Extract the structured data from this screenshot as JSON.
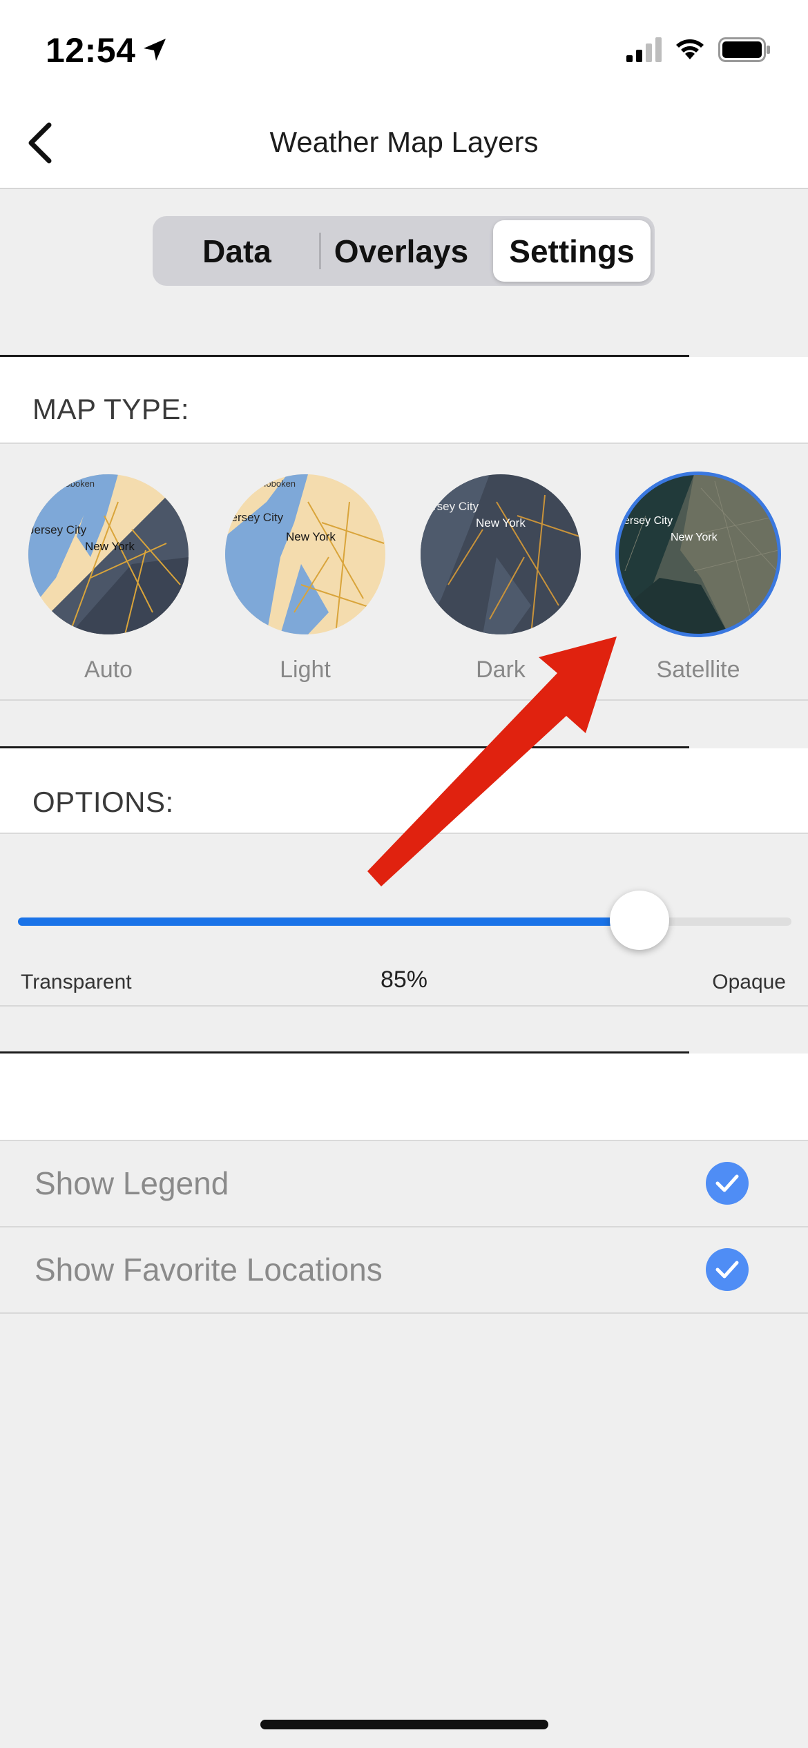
{
  "status_bar": {
    "time": "12:54",
    "icons": [
      "location-arrow-icon",
      "cellular-signal-icon",
      "wifi-icon",
      "battery-icon"
    ]
  },
  "nav": {
    "title": "Weather Map Layers",
    "back_icon": "chevron-left-icon"
  },
  "tabs": [
    {
      "label": "Data",
      "selected": false
    },
    {
      "label": "Overlays",
      "selected": false
    },
    {
      "label": "Settings",
      "selected": true
    }
  ],
  "map_type": {
    "header": "MAP TYPE:",
    "options": [
      {
        "label": "Auto",
        "selected": false
      },
      {
        "label": "Light",
        "selected": false
      },
      {
        "label": "Dark",
        "selected": false
      },
      {
        "label": "Satellite",
        "selected": true
      }
    ],
    "thumbnail_text": {
      "jersey_city": "Jersey City",
      "new_york": "New York",
      "hoboken": "Hoboken"
    }
  },
  "options": {
    "header": "OPTIONS:",
    "opacity": {
      "min_label": "Transparent",
      "max_label": "Opaque",
      "value": 0.85,
      "value_label": "85%"
    }
  },
  "toggles": [
    {
      "label": "Show Legend",
      "checked": true
    },
    {
      "label": "Show Favorite Locations",
      "checked": true
    }
  ],
  "colors": {
    "accent": "#1a73e8",
    "check": "#4f8df5",
    "selected_ring": "#3a78e0",
    "annotation_arrow": "#e0220f"
  }
}
